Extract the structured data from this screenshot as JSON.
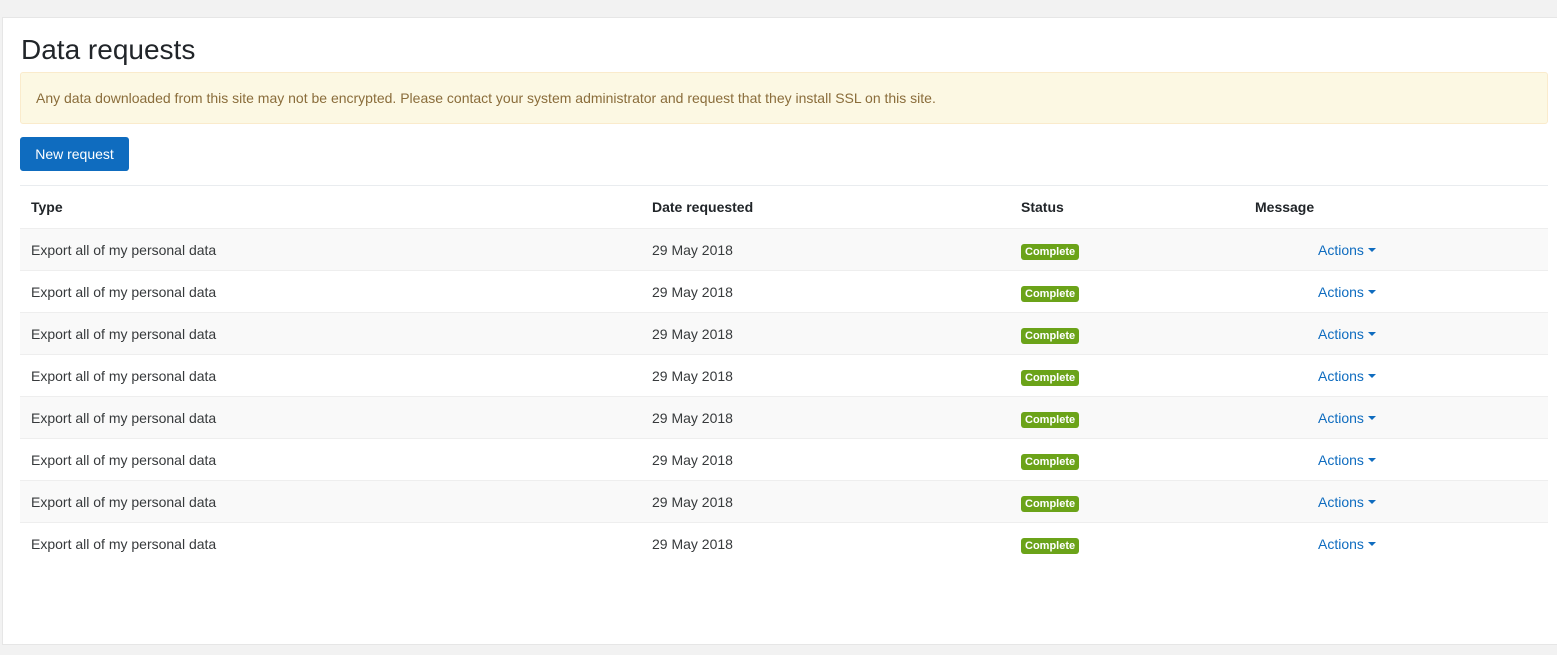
{
  "page": {
    "title": "Data requests",
    "alert_text": "Any data downloaded from this site may not be encrypted. Please contact your system administrator and request that they install SSL on this site.",
    "new_request_label": "New request"
  },
  "table": {
    "headers": {
      "type": "Type",
      "date": "Date requested",
      "status": "Status",
      "message": "Message"
    },
    "rows": [
      {
        "type": "Export all of my personal data",
        "date": "29 May 2018",
        "status": "Complete",
        "actions": "Actions"
      },
      {
        "type": "Export all of my personal data",
        "date": "29 May 2018",
        "status": "Complete",
        "actions": "Actions"
      },
      {
        "type": "Export all of my personal data",
        "date": "29 May 2018",
        "status": "Complete",
        "actions": "Actions"
      },
      {
        "type": "Export all of my personal data",
        "date": "29 May 2018",
        "status": "Complete",
        "actions": "Actions"
      },
      {
        "type": "Export all of my personal data",
        "date": "29 May 2018",
        "status": "Complete",
        "actions": "Actions"
      },
      {
        "type": "Export all of my personal data",
        "date": "29 May 2018",
        "status": "Complete",
        "actions": "Actions"
      },
      {
        "type": "Export all of my personal data",
        "date": "29 May 2018",
        "status": "Complete",
        "actions": "Actions"
      },
      {
        "type": "Export all of my personal data",
        "date": "29 May 2018",
        "status": "Complete",
        "actions": "Actions"
      }
    ]
  },
  "colors": {
    "primary": "#0f6cbf",
    "success_badge": "#6ba319",
    "alert_bg": "#fcf8e3",
    "alert_text": "#8a6d3b"
  },
  "icons": {
    "actions_menu": "caret-down-icon"
  }
}
